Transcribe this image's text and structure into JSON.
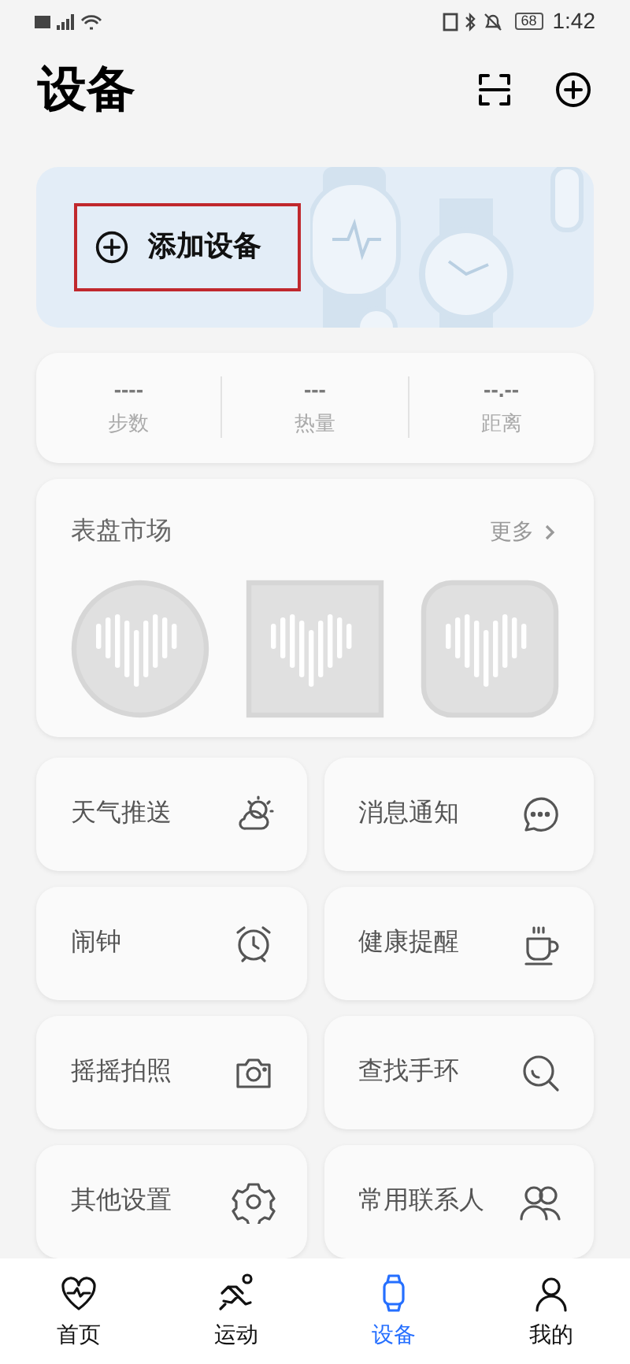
{
  "status_bar": {
    "time": "1:42",
    "battery": "68"
  },
  "header": {
    "title": "设备"
  },
  "add_device": {
    "label": "添加设备",
    "highlighted": true
  },
  "stats": [
    {
      "value": "----",
      "label": "步数"
    },
    {
      "value": "---",
      "label": "热量"
    },
    {
      "value": "--.--",
      "label": "距离"
    }
  ],
  "dial_market": {
    "title": "表盘市场",
    "more": "更多",
    "dials": [
      {
        "kind": "round"
      },
      {
        "kind": "square"
      },
      {
        "kind": "rounded"
      }
    ]
  },
  "features": [
    {
      "label": "天气推送",
      "kind": "weather"
    },
    {
      "label": "消息通知",
      "kind": "message"
    },
    {
      "label": "闹钟",
      "kind": "alarm"
    },
    {
      "label": "健康提醒",
      "kind": "cup"
    },
    {
      "label": "摇摇拍照",
      "kind": "camera"
    },
    {
      "label": "查找手环",
      "kind": "find"
    },
    {
      "label": "其他设置",
      "kind": "gear"
    },
    {
      "label": "常用联系人",
      "kind": "contacts"
    }
  ],
  "bottom_nav": [
    {
      "label": "首页",
      "kind": "health",
      "selected": false
    },
    {
      "label": "运动",
      "kind": "run",
      "selected": false
    },
    {
      "label": "设备",
      "kind": "device",
      "selected": true
    },
    {
      "label": "我的",
      "kind": "me",
      "selected": false
    }
  ]
}
